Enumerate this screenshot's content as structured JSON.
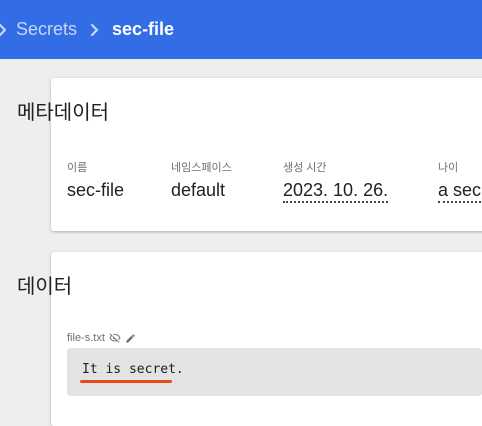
{
  "breadcrumb": {
    "parent_label": "Secrets",
    "current_label": "sec-file"
  },
  "metadata": {
    "title": "메타데이터",
    "fields": [
      {
        "label": "이름",
        "value": "sec-file"
      },
      {
        "label": "네임스페이스",
        "value": "default"
      },
      {
        "label": "생성 시간",
        "value": "2023. 10. 26."
      },
      {
        "label": "나이",
        "value": "a sec"
      }
    ]
  },
  "data": {
    "title": "데이터",
    "entry": {
      "key": "file-s.txt",
      "value": "It is secret."
    }
  },
  "colors": {
    "header": "#326de6",
    "annotation_underline": "#e64a19"
  },
  "icons": [
    "chevron-right-icon",
    "visibility-off-icon",
    "edit-icon"
  ]
}
